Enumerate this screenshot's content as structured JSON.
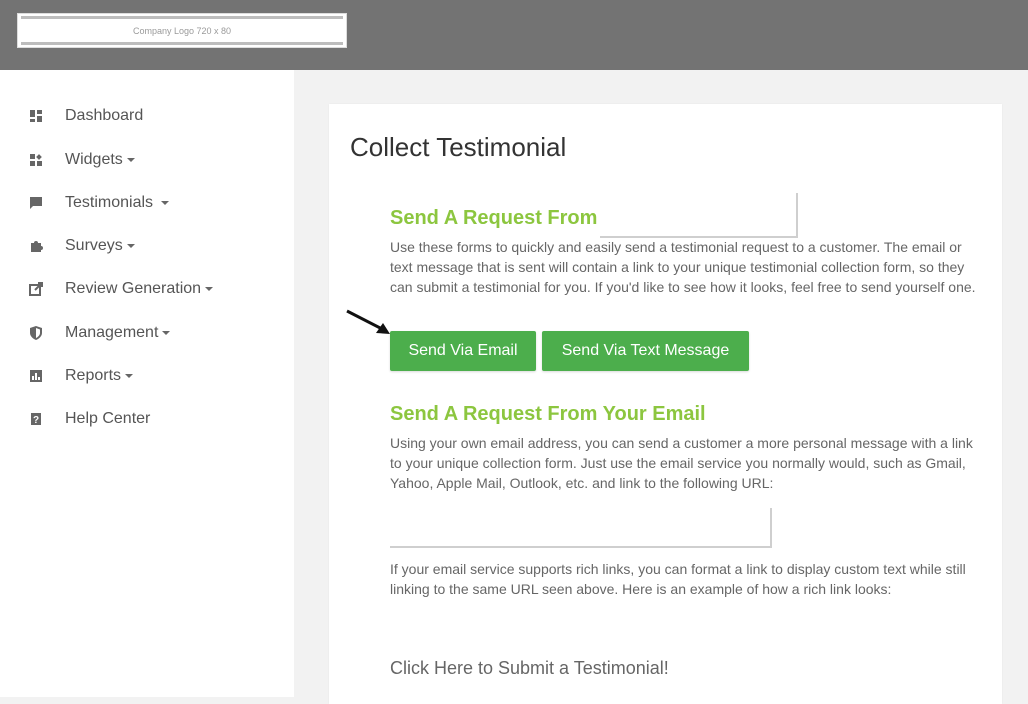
{
  "logo": {
    "text": "Company Logo 720 x 80"
  },
  "sidebar": {
    "items": [
      {
        "label": "Dashboard",
        "icon": "dashboard-icon",
        "caret": false
      },
      {
        "label": "Widgets",
        "icon": "widgets-icon",
        "caret": true
      },
      {
        "label": "Testimonials",
        "icon": "comment-icon",
        "caret": true
      },
      {
        "label": "Surveys",
        "icon": "puzzle-icon",
        "caret": true
      },
      {
        "label": "Review Generation",
        "icon": "share-icon",
        "caret": true
      },
      {
        "label": "Management",
        "icon": "shield-icon",
        "caret": true
      },
      {
        "label": "Reports",
        "icon": "chart-icon",
        "caret": true
      },
      {
        "label": "Help Center",
        "icon": "help-icon",
        "caret": false
      }
    ]
  },
  "main": {
    "title": "Collect Testimonial",
    "section1": {
      "title": "Send A Request From",
      "body": "Use these forms to quickly and easily send a testimonial request to a customer. The email or text message that is sent will contain a link to your unique testimonial collection form, so they can submit a testimonial for you. If you'd like to see how it looks, feel free to send yourself one."
    },
    "buttons": {
      "email": "Send Via Email",
      "text": "Send Via Text Message"
    },
    "section2": {
      "title": "Send A Request From Your Email",
      "body": "Using your own email address, you can send a customer a more personal message with a link to your unique collection form. Just use the email service you normally would, such as Gmail, Yahoo, Apple Mail, Outlook, etc. and link to the following URL:",
      "rich_body": "If your email service supports rich links, you can format a link to display custom text while still linking to the same URL seen above. Here is an example of how a rich link looks:",
      "rich_link": "Click Here to Submit a Testimonial!"
    }
  },
  "colors": {
    "accent": "#8cc63f",
    "button": "#4cae4c",
    "topbar": "#737373"
  }
}
